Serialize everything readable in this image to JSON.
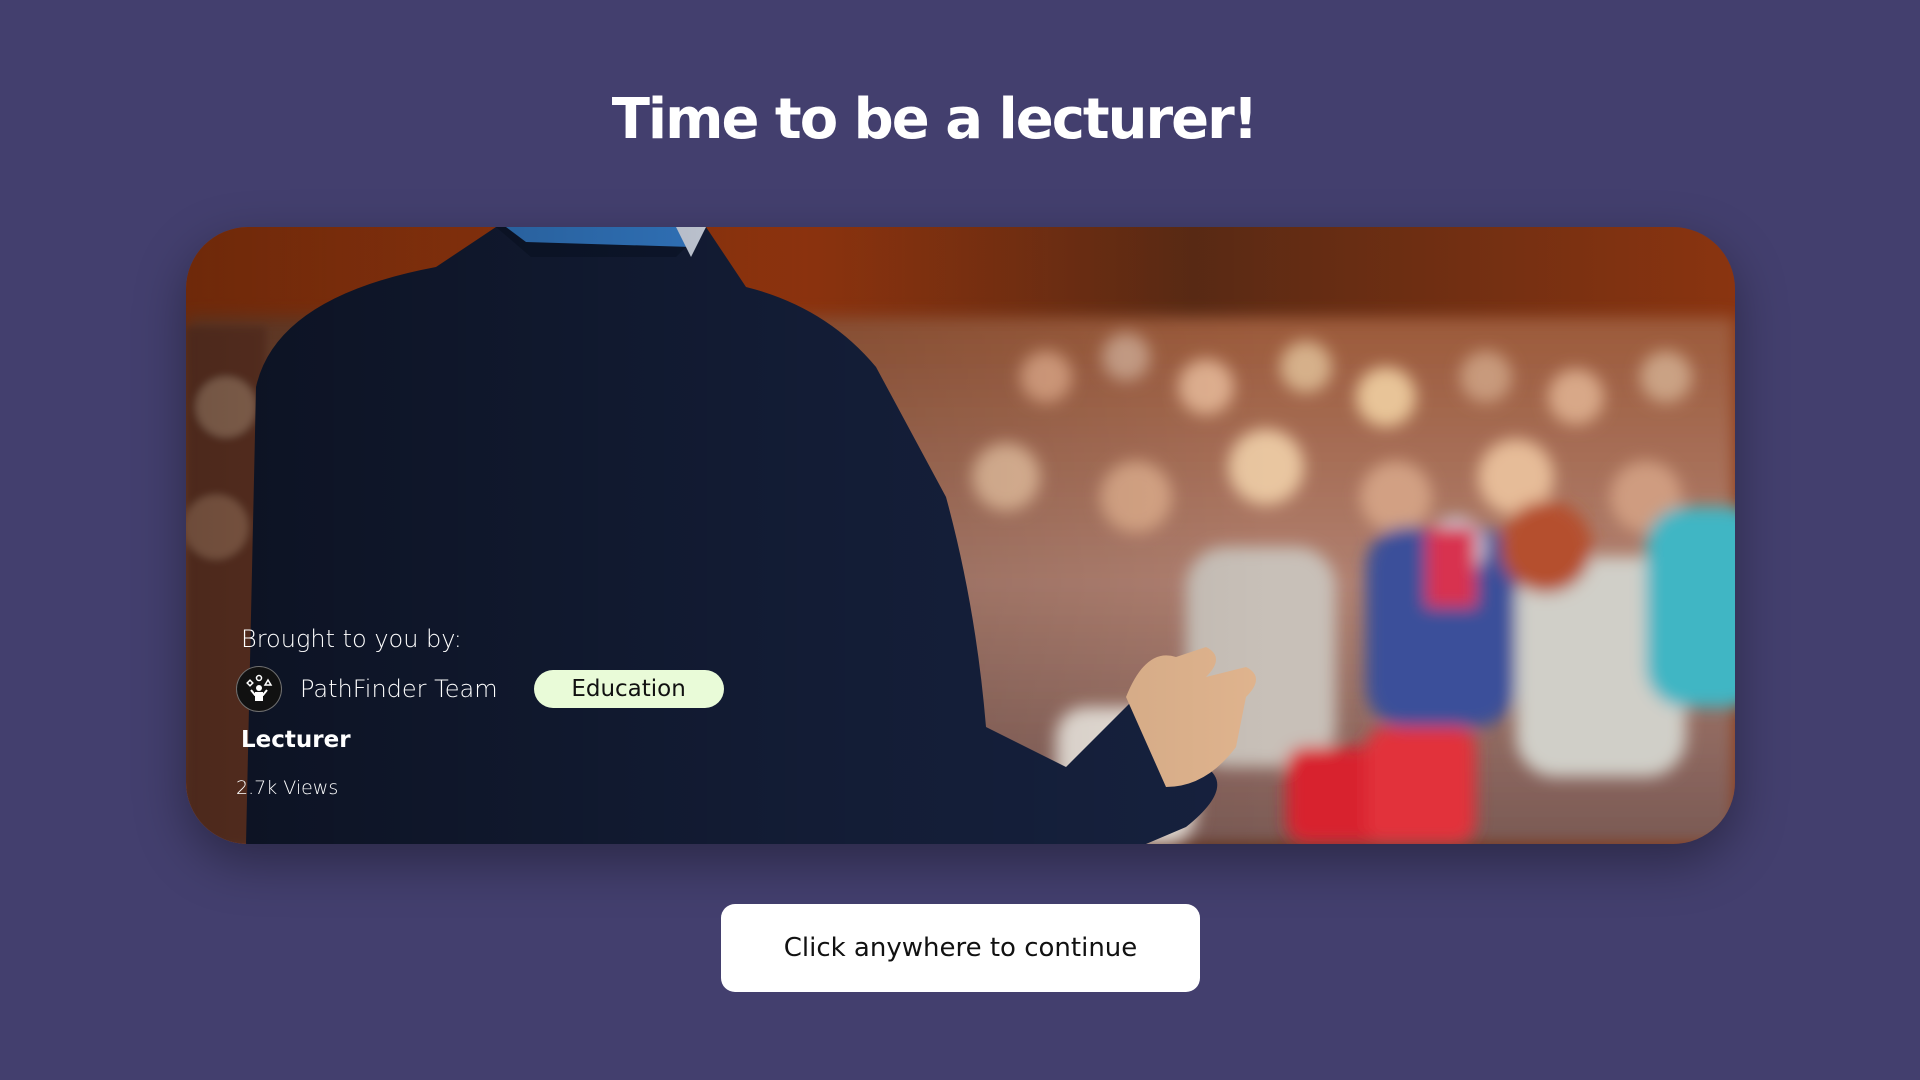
{
  "page": {
    "headline": "Time to be a lecturer!",
    "background_color": "#433f6e"
  },
  "card": {
    "brought_label": "Brought to you by:",
    "author": {
      "name": "PathFinder Team",
      "avatar_icon": "juggler-icon"
    },
    "category": {
      "label": "Education",
      "color": "#e9fbd8"
    },
    "title": "Lecturer",
    "views": "2.7k Views",
    "image_subject": "speaker-addressing-audience-photo"
  },
  "continue_button": {
    "label": "Click anywhere to continue"
  }
}
